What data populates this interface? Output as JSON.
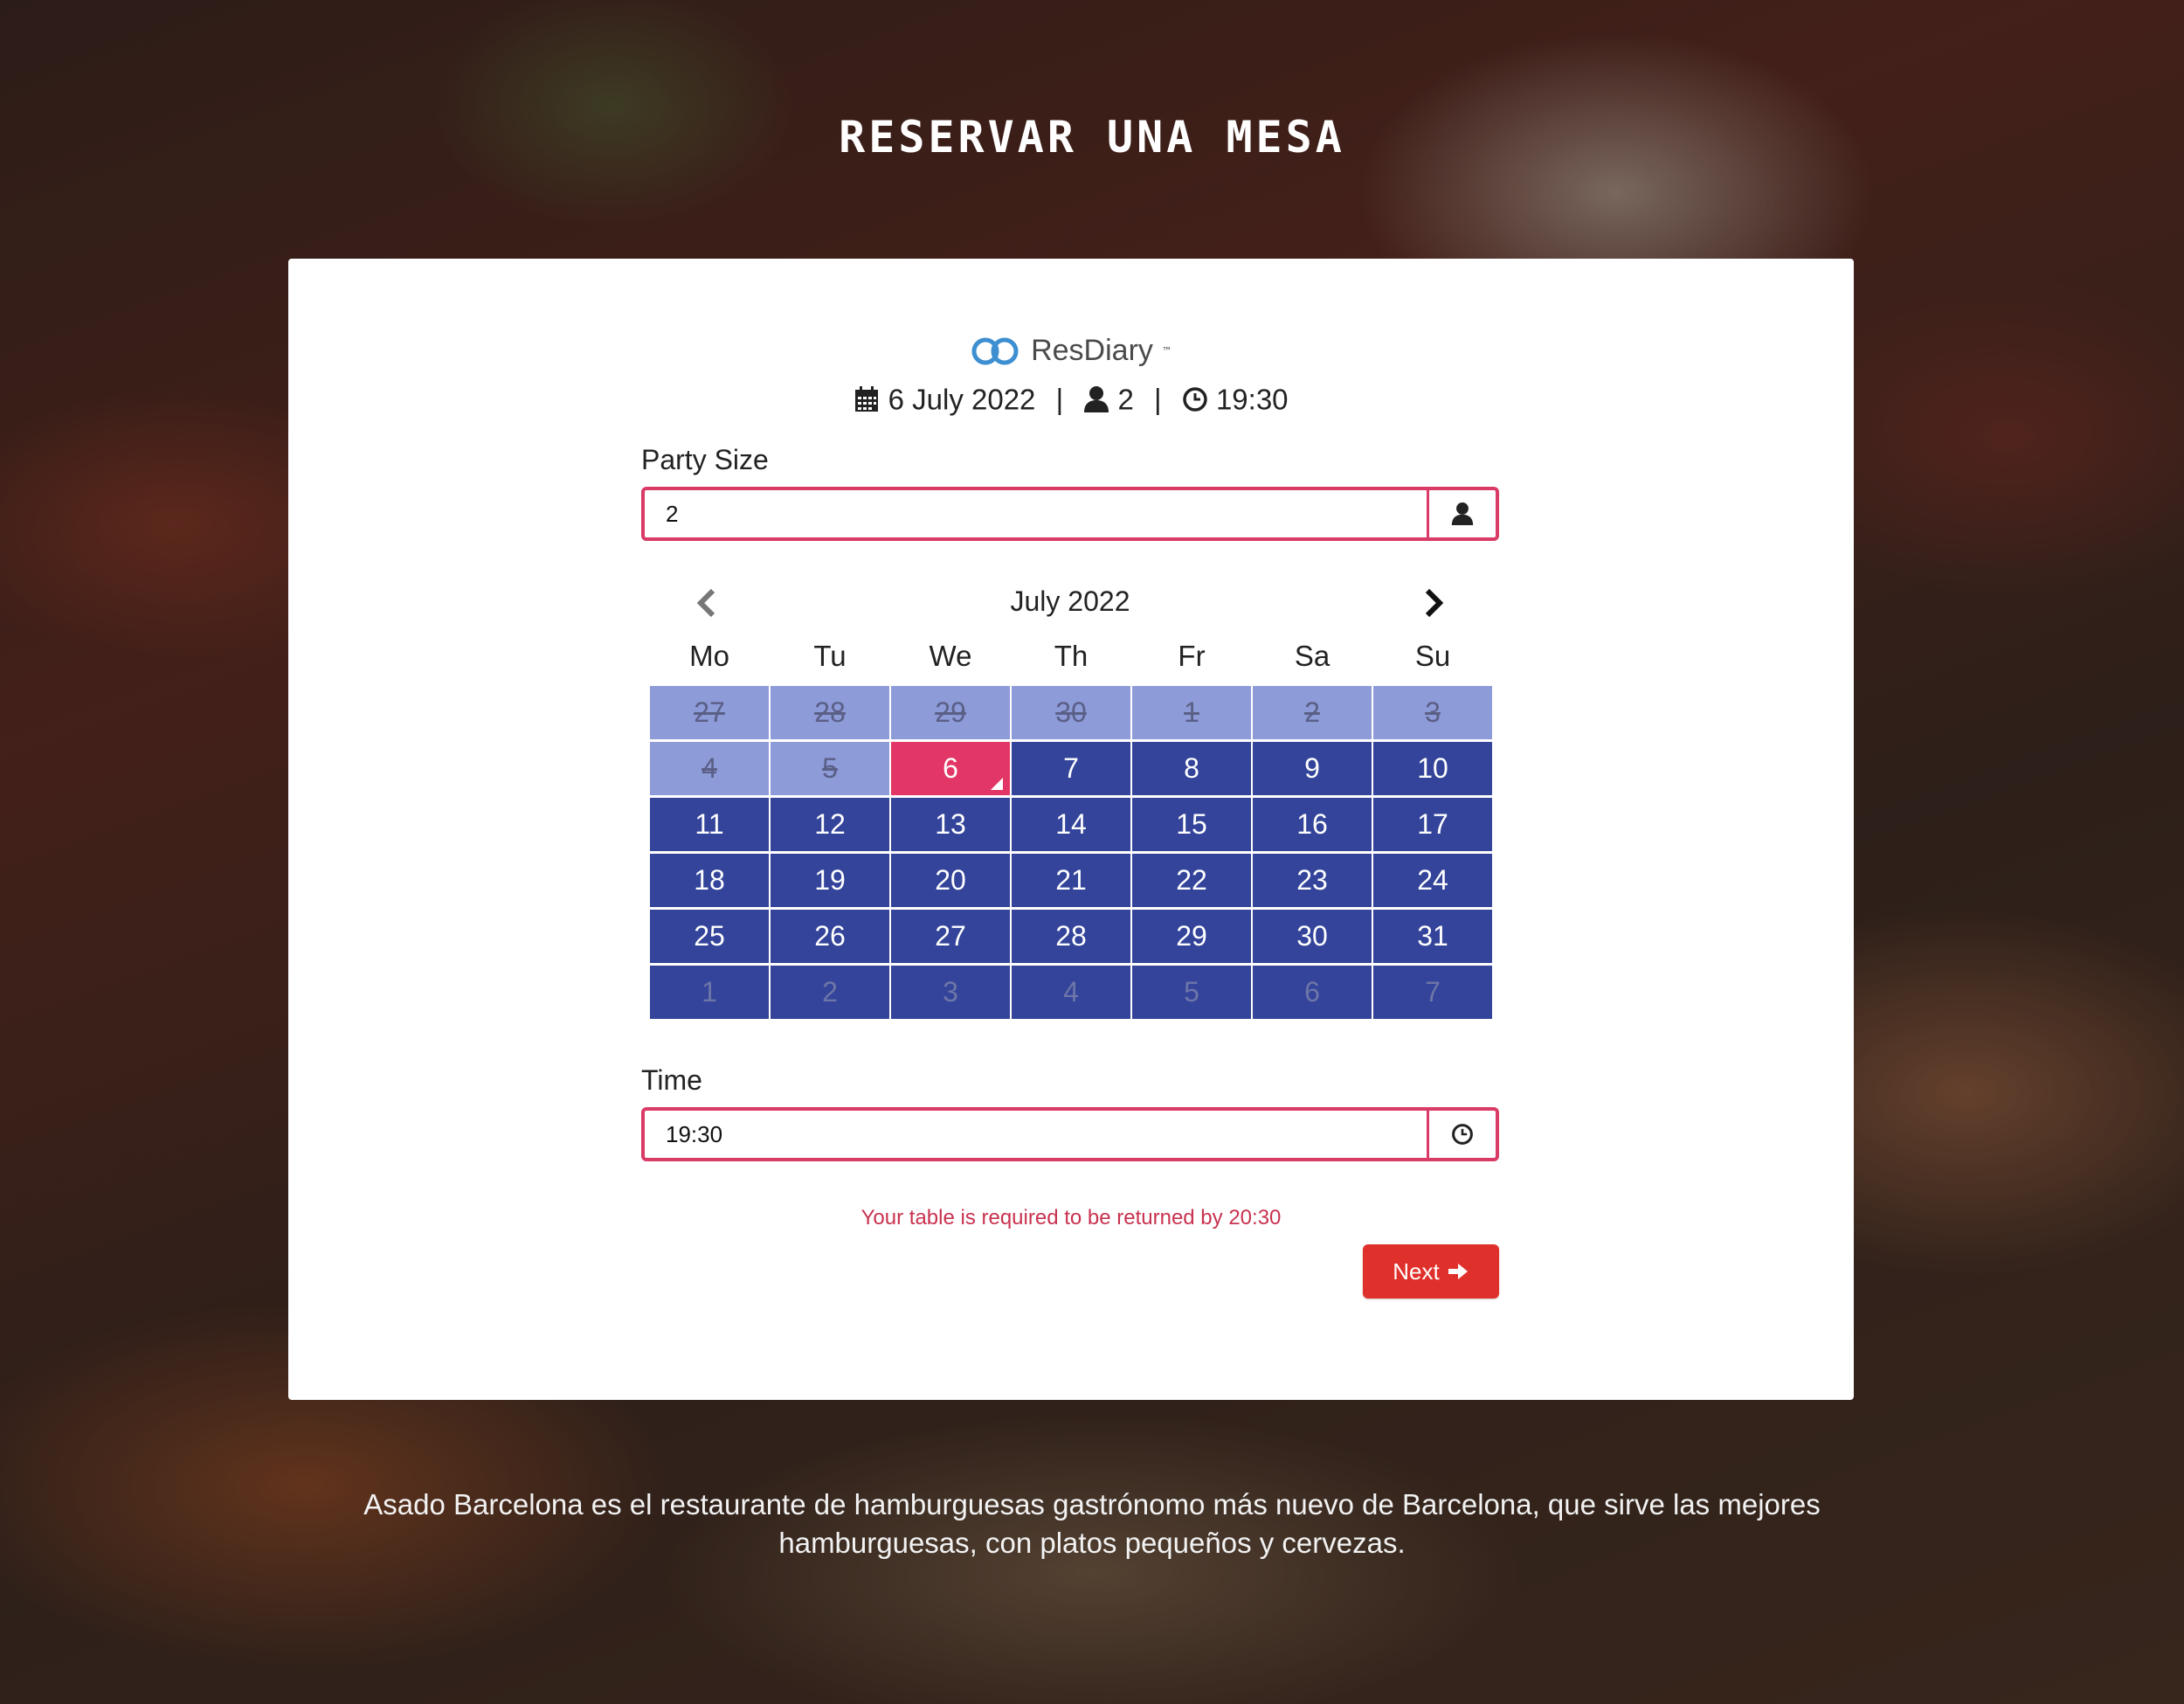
{
  "page": {
    "title": "RESERVAR UNA MESA",
    "description": "Asado Barcelona es el restaurante de hamburguesas gastrónomo más nuevo de Barcelona, que sirve las mejores hamburguesas, con platos pequeños y cervezas."
  },
  "widget": {
    "brand": "ResDiary",
    "brand_tm": "™",
    "summary": {
      "date": "6 July 2022",
      "separator": "|",
      "party": "2",
      "time": "19:30"
    },
    "party_size": {
      "label": "Party Size",
      "value": "2",
      "icon": "user-icon"
    },
    "calendar": {
      "month_label": "July 2022",
      "weekdays": [
        "Mo",
        "Tu",
        "We",
        "Th",
        "Fr",
        "Sa",
        "Su"
      ],
      "days": [
        {
          "label": "27",
          "state": "past"
        },
        {
          "label": "28",
          "state": "past"
        },
        {
          "label": "29",
          "state": "past"
        },
        {
          "label": "30",
          "state": "past"
        },
        {
          "label": "1",
          "state": "past"
        },
        {
          "label": "2",
          "state": "past"
        },
        {
          "label": "3",
          "state": "past"
        },
        {
          "label": "4",
          "state": "past"
        },
        {
          "label": "5",
          "state": "past"
        },
        {
          "label": "6",
          "state": "selected"
        },
        {
          "label": "7",
          "state": "avail"
        },
        {
          "label": "8",
          "state": "avail"
        },
        {
          "label": "9",
          "state": "avail"
        },
        {
          "label": "10",
          "state": "avail"
        },
        {
          "label": "11",
          "state": "avail"
        },
        {
          "label": "12",
          "state": "avail"
        },
        {
          "label": "13",
          "state": "avail"
        },
        {
          "label": "14",
          "state": "avail"
        },
        {
          "label": "15",
          "state": "avail"
        },
        {
          "label": "16",
          "state": "avail"
        },
        {
          "label": "17",
          "state": "avail"
        },
        {
          "label": "18",
          "state": "avail"
        },
        {
          "label": "19",
          "state": "avail"
        },
        {
          "label": "20",
          "state": "avail"
        },
        {
          "label": "21",
          "state": "avail"
        },
        {
          "label": "22",
          "state": "avail"
        },
        {
          "label": "23",
          "state": "avail"
        },
        {
          "label": "24",
          "state": "avail"
        },
        {
          "label": "25",
          "state": "avail"
        },
        {
          "label": "26",
          "state": "avail"
        },
        {
          "label": "27",
          "state": "avail"
        },
        {
          "label": "28",
          "state": "avail"
        },
        {
          "label": "29",
          "state": "avail"
        },
        {
          "label": "30",
          "state": "avail"
        },
        {
          "label": "31",
          "state": "avail"
        },
        {
          "label": "1",
          "state": "next-month"
        },
        {
          "label": "2",
          "state": "next-month"
        },
        {
          "label": "3",
          "state": "next-month"
        },
        {
          "label": "4",
          "state": "next-month"
        },
        {
          "label": "5",
          "state": "next-month"
        },
        {
          "label": "6",
          "state": "next-month"
        },
        {
          "label": "7",
          "state": "next-month"
        }
      ]
    },
    "time": {
      "label": "Time",
      "value": "19:30",
      "icon": "clock-icon"
    },
    "notice": "Your table is required to be returned by 20:30",
    "next_button": {
      "label": "Next"
    }
  },
  "colors": {
    "accent_pink": "#e23766",
    "available_day": "#33449a",
    "past_day": "#8e9bd9",
    "next_button": "#e0302b",
    "logo_blue": "#3d8fd1"
  }
}
